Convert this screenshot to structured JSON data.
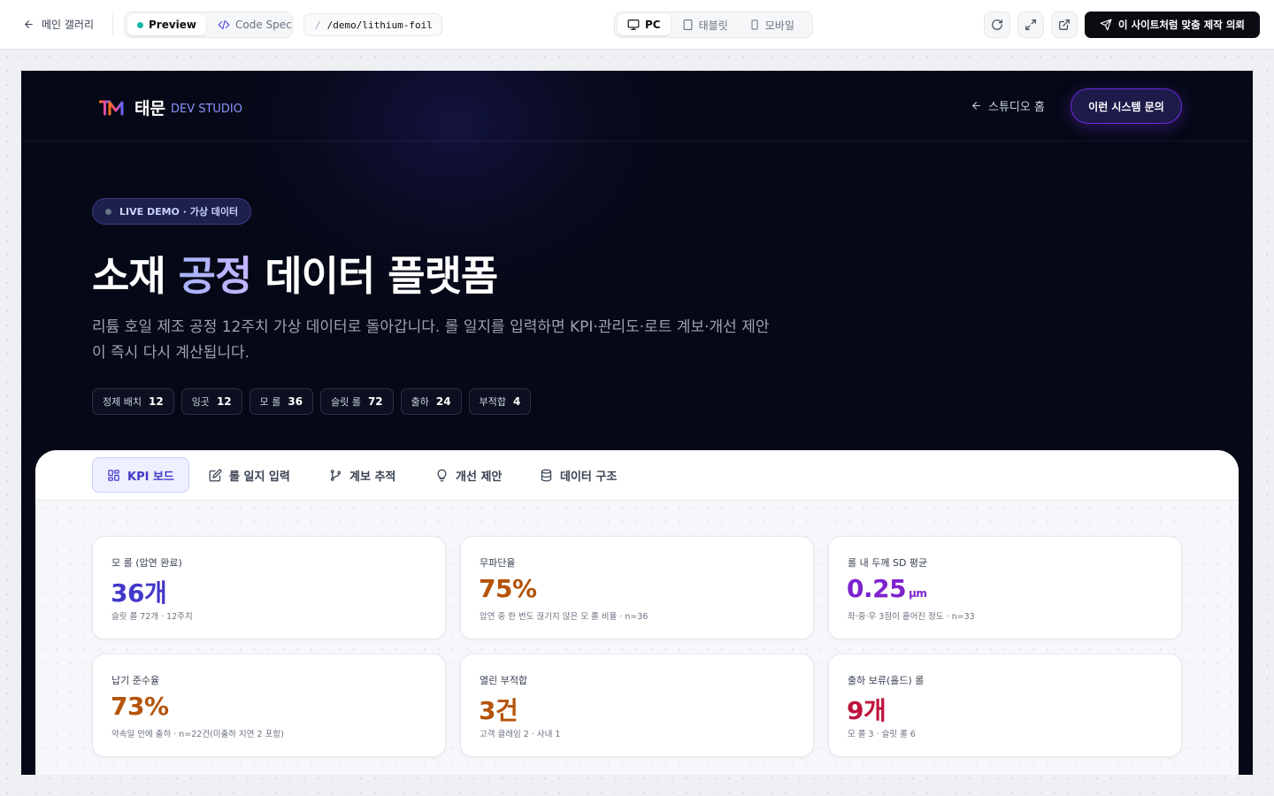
{
  "toolbar": {
    "back_label": "메인 갤러리",
    "view_tabs": [
      {
        "label": "Preview"
      },
      {
        "label": "Code Spec"
      }
    ],
    "path": "/demo/lithium-foil",
    "devices": [
      {
        "label": "PC"
      },
      {
        "label": "태블릿"
      },
      {
        "label": "모바일"
      }
    ],
    "cta_label": "이 사이트처럼 맞춤 제작 의뢰",
    "icons": [
      "refresh-icon",
      "expand-icon",
      "external-link-icon"
    ]
  },
  "site": {
    "brand": "태문",
    "brand_sub": "DEV STUDIO",
    "home_link": "스튜디오 홈",
    "cta": "이런 시스템 문의"
  },
  "hero": {
    "badge": "LIVE DEMO · 가상 데이터",
    "title_part1": "소재 ",
    "title_accent": "공정",
    "title_part2": " 데이터 플랫폼",
    "description": "리튬 호일 제조 공정 12주치 가상 데이터로 돌아갑니다. 롤 일지를 입력하면 KPI·관리도·로트 계보·개선 제안이 즉시 다시 계산됩니다.",
    "stats": [
      {
        "label": "정제 배치",
        "value": "12"
      },
      {
        "label": "잉곳",
        "value": "12"
      },
      {
        "label": "모 롤",
        "value": "36"
      },
      {
        "label": "슬릿 롤",
        "value": "72"
      },
      {
        "label": "출하",
        "value": "24"
      },
      {
        "label": "부적합",
        "value": "4"
      }
    ]
  },
  "tabs": [
    {
      "label": "KPI 보드",
      "icon": "grid-icon"
    },
    {
      "label": "롤 일지 입력",
      "icon": "edit-icon"
    },
    {
      "label": "계보 추적",
      "icon": "branch-icon"
    },
    {
      "label": "개선 제안",
      "icon": "lightbulb-icon"
    },
    {
      "label": "데이터 구조",
      "icon": "database-icon"
    }
  ],
  "kpis": [
    {
      "label": "모 롤 (압연 완료)",
      "value": "36개",
      "unit": "",
      "sub": "슬릿 롤 72개 · 12주치",
      "color": "#4338ca"
    },
    {
      "label": "무파단율",
      "value": "75%",
      "unit": "",
      "sub": "압연 중 한 번도 끊기지 않은 모 롤 비율 · n=36",
      "color": "#b45309"
    },
    {
      "label": "롤 내 두께 SD 평균",
      "value": "0.25",
      "unit": "μm",
      "sub": "좌·중·우 3점이 흩어진 정도 · n=33",
      "color": "#7e22ce"
    },
    {
      "label": "납기 준수율",
      "value": "73%",
      "unit": "",
      "sub": "약속일 안에 출하 · n=22건(미출하 지연 2 포함)",
      "color": "#b45309"
    },
    {
      "label": "열린 부적합",
      "value": "3건",
      "unit": "",
      "sub": "고객 클레임 2 · 사내 1",
      "color": "#b45309"
    },
    {
      "label": "출하 보류(홀드) 롤",
      "value": "9개",
      "unit": "",
      "sub": "모 롤 3 · 슬릿 롤 6",
      "color": "#be123c"
    }
  ]
}
